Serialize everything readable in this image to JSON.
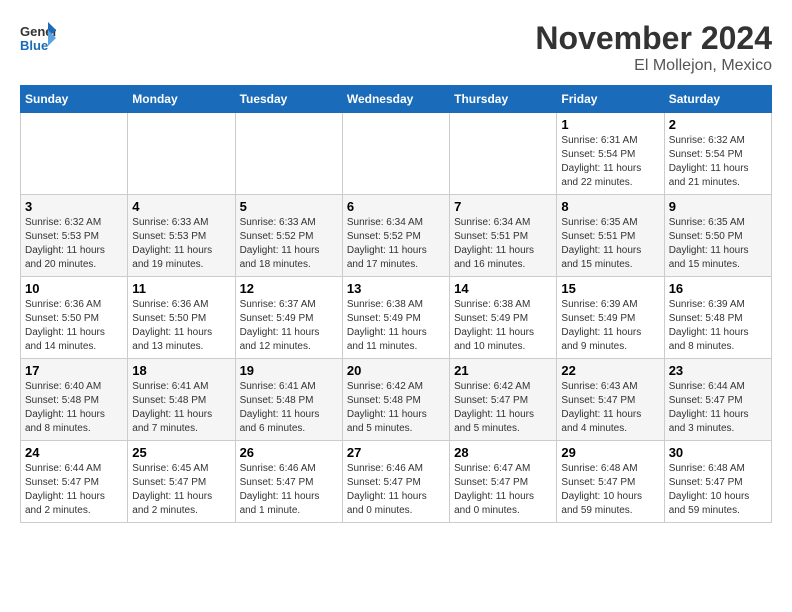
{
  "logo": {
    "line1": "General",
    "line2": "Blue"
  },
  "title": "November 2024",
  "subtitle": "El Mollejon, Mexico",
  "days_of_week": [
    "Sunday",
    "Monday",
    "Tuesday",
    "Wednesday",
    "Thursday",
    "Friday",
    "Saturday"
  ],
  "weeks": [
    [
      {
        "day": "",
        "info": ""
      },
      {
        "day": "",
        "info": ""
      },
      {
        "day": "",
        "info": ""
      },
      {
        "day": "",
        "info": ""
      },
      {
        "day": "",
        "info": ""
      },
      {
        "day": "1",
        "info": "Sunrise: 6:31 AM\nSunset: 5:54 PM\nDaylight: 11 hours and 22 minutes."
      },
      {
        "day": "2",
        "info": "Sunrise: 6:32 AM\nSunset: 5:54 PM\nDaylight: 11 hours and 21 minutes."
      }
    ],
    [
      {
        "day": "3",
        "info": "Sunrise: 6:32 AM\nSunset: 5:53 PM\nDaylight: 11 hours and 20 minutes."
      },
      {
        "day": "4",
        "info": "Sunrise: 6:33 AM\nSunset: 5:53 PM\nDaylight: 11 hours and 19 minutes."
      },
      {
        "day": "5",
        "info": "Sunrise: 6:33 AM\nSunset: 5:52 PM\nDaylight: 11 hours and 18 minutes."
      },
      {
        "day": "6",
        "info": "Sunrise: 6:34 AM\nSunset: 5:52 PM\nDaylight: 11 hours and 17 minutes."
      },
      {
        "day": "7",
        "info": "Sunrise: 6:34 AM\nSunset: 5:51 PM\nDaylight: 11 hours and 16 minutes."
      },
      {
        "day": "8",
        "info": "Sunrise: 6:35 AM\nSunset: 5:51 PM\nDaylight: 11 hours and 15 minutes."
      },
      {
        "day": "9",
        "info": "Sunrise: 6:35 AM\nSunset: 5:50 PM\nDaylight: 11 hours and 15 minutes."
      }
    ],
    [
      {
        "day": "10",
        "info": "Sunrise: 6:36 AM\nSunset: 5:50 PM\nDaylight: 11 hours and 14 minutes."
      },
      {
        "day": "11",
        "info": "Sunrise: 6:36 AM\nSunset: 5:50 PM\nDaylight: 11 hours and 13 minutes."
      },
      {
        "day": "12",
        "info": "Sunrise: 6:37 AM\nSunset: 5:49 PM\nDaylight: 11 hours and 12 minutes."
      },
      {
        "day": "13",
        "info": "Sunrise: 6:38 AM\nSunset: 5:49 PM\nDaylight: 11 hours and 11 minutes."
      },
      {
        "day": "14",
        "info": "Sunrise: 6:38 AM\nSunset: 5:49 PM\nDaylight: 11 hours and 10 minutes."
      },
      {
        "day": "15",
        "info": "Sunrise: 6:39 AM\nSunset: 5:49 PM\nDaylight: 11 hours and 9 minutes."
      },
      {
        "day": "16",
        "info": "Sunrise: 6:39 AM\nSunset: 5:48 PM\nDaylight: 11 hours and 8 minutes."
      }
    ],
    [
      {
        "day": "17",
        "info": "Sunrise: 6:40 AM\nSunset: 5:48 PM\nDaylight: 11 hours and 8 minutes."
      },
      {
        "day": "18",
        "info": "Sunrise: 6:41 AM\nSunset: 5:48 PM\nDaylight: 11 hours and 7 minutes."
      },
      {
        "day": "19",
        "info": "Sunrise: 6:41 AM\nSunset: 5:48 PM\nDaylight: 11 hours and 6 minutes."
      },
      {
        "day": "20",
        "info": "Sunrise: 6:42 AM\nSunset: 5:48 PM\nDaylight: 11 hours and 5 minutes."
      },
      {
        "day": "21",
        "info": "Sunrise: 6:42 AM\nSunset: 5:47 PM\nDaylight: 11 hours and 5 minutes."
      },
      {
        "day": "22",
        "info": "Sunrise: 6:43 AM\nSunset: 5:47 PM\nDaylight: 11 hours and 4 minutes."
      },
      {
        "day": "23",
        "info": "Sunrise: 6:44 AM\nSunset: 5:47 PM\nDaylight: 11 hours and 3 minutes."
      }
    ],
    [
      {
        "day": "24",
        "info": "Sunrise: 6:44 AM\nSunset: 5:47 PM\nDaylight: 11 hours and 2 minutes."
      },
      {
        "day": "25",
        "info": "Sunrise: 6:45 AM\nSunset: 5:47 PM\nDaylight: 11 hours and 2 minutes."
      },
      {
        "day": "26",
        "info": "Sunrise: 6:46 AM\nSunset: 5:47 PM\nDaylight: 11 hours and 1 minute."
      },
      {
        "day": "27",
        "info": "Sunrise: 6:46 AM\nSunset: 5:47 PM\nDaylight: 11 hours and 0 minutes."
      },
      {
        "day": "28",
        "info": "Sunrise: 6:47 AM\nSunset: 5:47 PM\nDaylight: 11 hours and 0 minutes."
      },
      {
        "day": "29",
        "info": "Sunrise: 6:48 AM\nSunset: 5:47 PM\nDaylight: 10 hours and 59 minutes."
      },
      {
        "day": "30",
        "info": "Sunrise: 6:48 AM\nSunset: 5:47 PM\nDaylight: 10 hours and 59 minutes."
      }
    ]
  ]
}
